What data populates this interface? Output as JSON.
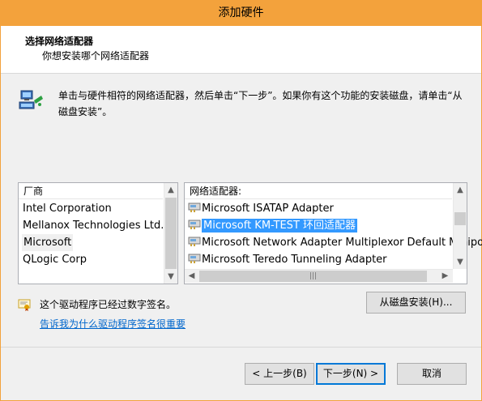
{
  "window": {
    "title": "添加硬件"
  },
  "header": {
    "title": "选择网络适配器",
    "subtitle": "你想安装哪个网络适配器"
  },
  "description": "单击与硬件相符的网络适配器，然后单击“下一步”。如果你有这个功能的安装磁盘，请单击“从磁盘安装”。",
  "manufacturer_list": {
    "header": "厂商",
    "items": [
      "Intel Corporation",
      "Mellanox Technologies Ltd.",
      "Microsoft",
      "QLogic Corp"
    ],
    "selected": "Microsoft"
  },
  "adapter_list": {
    "header": "网络适配器:",
    "items": [
      "Microsoft ISATAP Adapter",
      "Microsoft KM-TEST 环回适配器",
      "Microsoft Network Adapter Multiplexor Default Miniport",
      "Microsoft Teredo Tunneling Adapter"
    ],
    "selected": "Microsoft KM-TEST 环回适配器"
  },
  "driver": {
    "signed_text": "这个驱动程序已经过数字签名。",
    "link_text": "告诉我为什么驱动程序签名很重要"
  },
  "buttons": {
    "have_disk": "从磁盘安装(H)...",
    "back": "< 上一步(B)",
    "next": "下一步(N) >",
    "cancel": "取消"
  },
  "icons": {
    "network": "network-adapter-icon",
    "certificate": "certificate-icon",
    "adapter": "adapter-item-icon"
  },
  "colors": {
    "title_bar": "#f3a23c",
    "selection": "#3399ff",
    "link": "#0066cc",
    "default_button_border": "#0078d7"
  }
}
